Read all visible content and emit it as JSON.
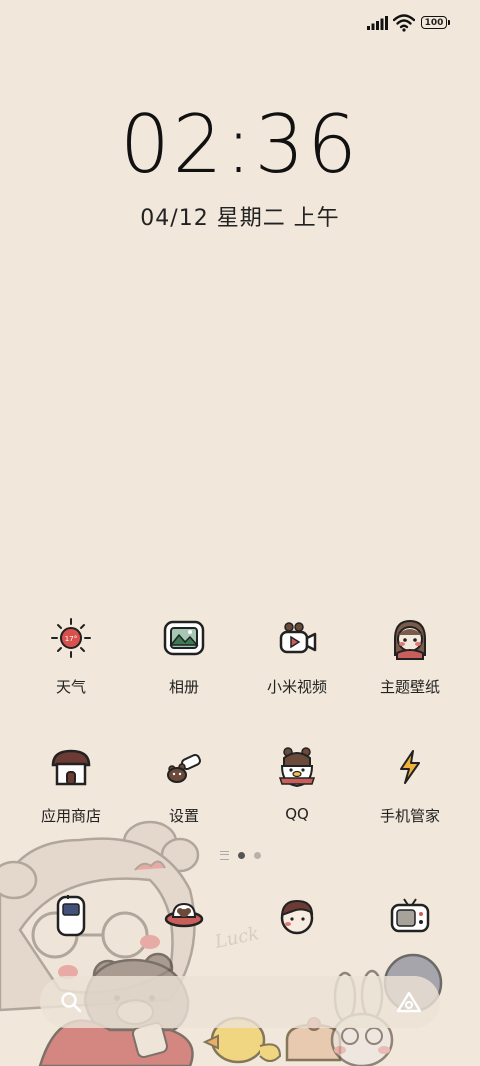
{
  "status_bar": {
    "signal_icon": "signal-bars-icon",
    "wifi_icon": "wifi-icon",
    "battery": "100"
  },
  "clock": {
    "time": "02:36",
    "date": "04/12 星期二 上午"
  },
  "apps": [
    {
      "label": "天气",
      "icon": "weather-sun-icon"
    },
    {
      "label": "相册",
      "icon": "gallery-icon"
    },
    {
      "label": "小米视频",
      "icon": "video-camera-icon"
    },
    {
      "label": "主题壁纸",
      "icon": "theme-girl-icon"
    },
    {
      "label": "应用商店",
      "icon": "app-store-house-icon"
    },
    {
      "label": "设置",
      "icon": "settings-bear-icon"
    },
    {
      "label": "QQ",
      "icon": "qq-penguin-icon"
    },
    {
      "label": "手机管家",
      "icon": "security-lightning-icon"
    }
  ],
  "dock": [
    {
      "icon": "phone-icon"
    },
    {
      "icon": "messages-ufo-icon"
    },
    {
      "icon": "contacts-face-icon"
    },
    {
      "icon": "camera-tv-icon"
    }
  ],
  "search": {
    "search_icon": "search-icon",
    "assistant_icon": "assistant-triangle-icon"
  },
  "wallpaper_text": "Luck",
  "colors": {
    "background": "#f1e7da",
    "text": "#222222"
  }
}
